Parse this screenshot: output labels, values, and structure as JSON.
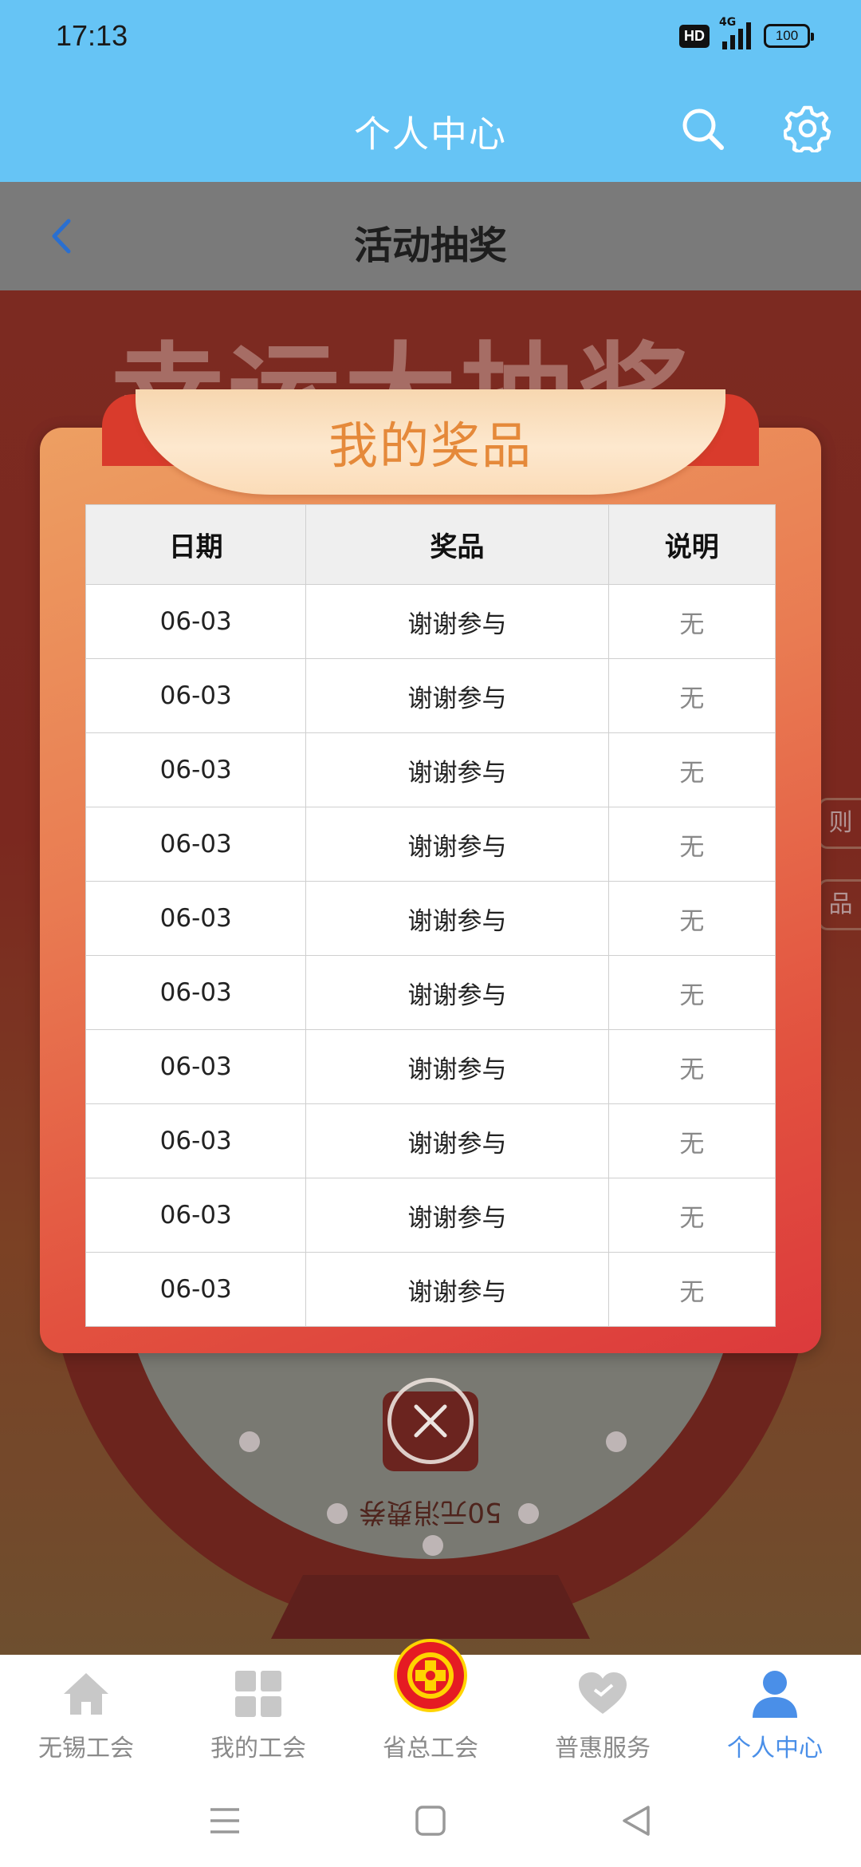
{
  "status_bar": {
    "time": "17:13",
    "hd": "HD",
    "network": "4G",
    "battery": "100"
  },
  "app_header": {
    "title": "个人中心",
    "search_icon": "search-icon",
    "settings_icon": "gear-icon"
  },
  "page_header": {
    "back_icon": "chevron-left-icon",
    "title": "活动抽奖"
  },
  "background": {
    "banner_title": "幸运大抽奖",
    "side_tabs": [
      "则",
      "品"
    ],
    "voucher_text": "50元消费券"
  },
  "modal": {
    "title": "我的奖品",
    "columns": [
      "日期",
      "奖品",
      "说明"
    ],
    "rows": [
      {
        "date": "06-03",
        "prize": "谢谢参与",
        "note": "无"
      },
      {
        "date": "06-03",
        "prize": "谢谢参与",
        "note": "无"
      },
      {
        "date": "06-03",
        "prize": "谢谢参与",
        "note": "无"
      },
      {
        "date": "06-03",
        "prize": "谢谢参与",
        "note": "无"
      },
      {
        "date": "06-03",
        "prize": "谢谢参与",
        "note": "无"
      },
      {
        "date": "06-03",
        "prize": "谢谢参与",
        "note": "无"
      },
      {
        "date": "06-03",
        "prize": "谢谢参与",
        "note": "无"
      },
      {
        "date": "06-03",
        "prize": "谢谢参与",
        "note": "无"
      },
      {
        "date": "06-03",
        "prize": "谢谢参与",
        "note": "无"
      },
      {
        "date": "06-03",
        "prize": "谢谢参与",
        "note": "无"
      }
    ],
    "close_icon": "close-circle-icon"
  },
  "tab_bar": {
    "items": [
      {
        "label": "无锡工会",
        "icon": "home-icon",
        "active": false
      },
      {
        "label": "我的工会",
        "icon": "grid-icon",
        "active": false
      },
      {
        "label": "省总工会",
        "icon": "union-logo-icon",
        "active": false
      },
      {
        "label": "普惠服务",
        "icon": "heart-icon",
        "active": false
      },
      {
        "label": "个人中心",
        "icon": "person-icon",
        "active": true
      }
    ]
  },
  "system_nav": {
    "menu_icon": "menu-icon",
    "home_icon": "square-home-icon",
    "back_icon": "triangle-back-icon"
  },
  "colors": {
    "header_blue": "#66c4f5",
    "accent_blue": "#4a8fe8",
    "modal_orange": "#e97b52",
    "modal_red": "#dc3a3c",
    "title_orange": "#e5893a"
  }
}
